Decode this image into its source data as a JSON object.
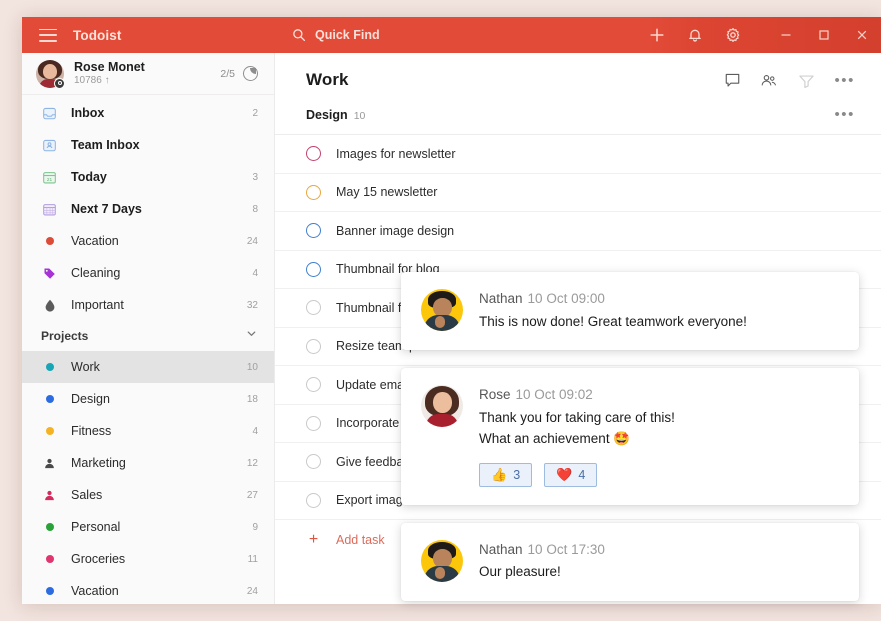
{
  "titlebar": {
    "brand": "Todoist",
    "menu_icon": "hamburger-icon",
    "search_label": "Quick Find",
    "actions": [
      {
        "name": "add-icon",
        "glyph": "+"
      },
      {
        "name": "notifications-bell-icon",
        "glyph": "bell"
      },
      {
        "name": "settings-gear-icon",
        "glyph": "gear"
      }
    ],
    "window_controls": [
      {
        "name": "minimize-button",
        "glyph": "minimize"
      },
      {
        "name": "maximize-button",
        "glyph": "maximize"
      },
      {
        "name": "close-button",
        "glyph": "close"
      }
    ],
    "accent_color": "#e24b37"
  },
  "sidebar": {
    "user": {
      "name": "Rose Monet",
      "karma": "10786 ↑",
      "progress": "2/5"
    },
    "nav": [
      {
        "label": "Inbox",
        "count": "2",
        "icon": "inbox-icon",
        "color": "#8fb4e3",
        "type": "glyph"
      },
      {
        "label": "Team Inbox",
        "count": "",
        "icon": "team-inbox-icon",
        "color": "#8fb4e3",
        "type": "glyph"
      },
      {
        "label": "Today",
        "count": "3",
        "icon": "today-calendar-icon",
        "color": "#7ec48f",
        "type": "glyph"
      },
      {
        "label": "Next 7 Days",
        "count": "8",
        "icon": "next-7-days-icon",
        "color": "#b49ce0",
        "type": "glyph"
      },
      {
        "label": "Vacation",
        "count": "24",
        "icon": "filter-dot-icon",
        "color": "#dd4b39",
        "type": "dot"
      },
      {
        "label": "Cleaning",
        "count": "4",
        "icon": "label-tag-icon",
        "color": "#a633d6",
        "type": "tag"
      },
      {
        "label": "Important",
        "count": "32",
        "icon": "label-drop-icon",
        "color": "#5b5b5b",
        "type": "drop"
      }
    ],
    "projects_header": {
      "label": "Projects",
      "chevron": "chevron-down-icon"
    },
    "projects": [
      {
        "label": "Work",
        "count": "10",
        "color": "#18a5b6",
        "type": "dot",
        "selected": true
      },
      {
        "label": "Design",
        "count": "18",
        "color": "#2d6ce0",
        "type": "dot",
        "selected": false
      },
      {
        "label": "Fitness",
        "count": "4",
        "color": "#f5b323",
        "type": "dot",
        "selected": false
      },
      {
        "label": "Marketing",
        "count": "12",
        "color": "#4a4a4a",
        "type": "person",
        "selected": false
      },
      {
        "label": "Sales",
        "count": "27",
        "color": "#d42b5e",
        "type": "person",
        "selected": false
      },
      {
        "label": "Personal",
        "count": "9",
        "color": "#2aa239",
        "type": "dot",
        "selected": false
      },
      {
        "label": "Groceries",
        "count": "11",
        "color": "#e0366f",
        "type": "dot",
        "selected": false
      },
      {
        "label": "Vacation",
        "count": "24",
        "color": "#2d6ce0",
        "type": "dot",
        "selected": false
      }
    ]
  },
  "main": {
    "title": "Work",
    "header_icons": [
      {
        "name": "comments-icon",
        "dim": false
      },
      {
        "name": "share-people-icon",
        "dim": false
      },
      {
        "name": "filter-icon",
        "dim": true
      }
    ],
    "header_more": "•••",
    "group": {
      "name": "Design",
      "count": "10",
      "more": "•••"
    },
    "tasks": [
      {
        "label": "Images for newsletter",
        "circle_color": "#c2436d"
      },
      {
        "label": "May 15 newsletter",
        "circle_color": "#eaa63c"
      },
      {
        "label": "Banner image design",
        "circle_color": "#3f7fd1"
      },
      {
        "label": "Thumbnail for blog",
        "circle_color": "#3f7fd1"
      },
      {
        "label": "Thumbnail for video",
        "circle_color": "#c9c9c9"
      },
      {
        "label": "Resize team photo",
        "circle_color": "#c9c9c9"
      },
      {
        "label": "Update email template",
        "circle_color": "#c9c9c9"
      },
      {
        "label": "Incorporate new brand",
        "circle_color": "#c9c9c9"
      },
      {
        "label": "Give feedback on draft",
        "circle_color": "#c9c9c9"
      },
      {
        "label": "Export image assets",
        "circle_color": "#c9c9c9"
      }
    ],
    "add_task": {
      "label": "Add task",
      "icon": "plus-icon"
    }
  },
  "comments": [
    {
      "author": "Nathan",
      "time": "10 Oct 09:00",
      "avatar": "nathan-avatar",
      "lines": [
        "This is now done! Great teamwork everyone!"
      ],
      "reactions": []
    },
    {
      "author": "Rose",
      "time": "10 Oct 09:02",
      "avatar": "rose-avatar",
      "lines": [
        "Thank you for taking care of this!",
        "What an achievement 🤩"
      ],
      "reactions": [
        {
          "emoji": "👍",
          "count": "3",
          "name": "thumbs-up-reaction"
        },
        {
          "emoji": "❤️",
          "count": "4",
          "name": "heart-reaction"
        }
      ]
    },
    {
      "author": "Nathan",
      "time": "10 Oct 17:30",
      "avatar": "nathan-avatar",
      "lines": [
        "Our pleasure!"
      ],
      "reactions": []
    }
  ]
}
